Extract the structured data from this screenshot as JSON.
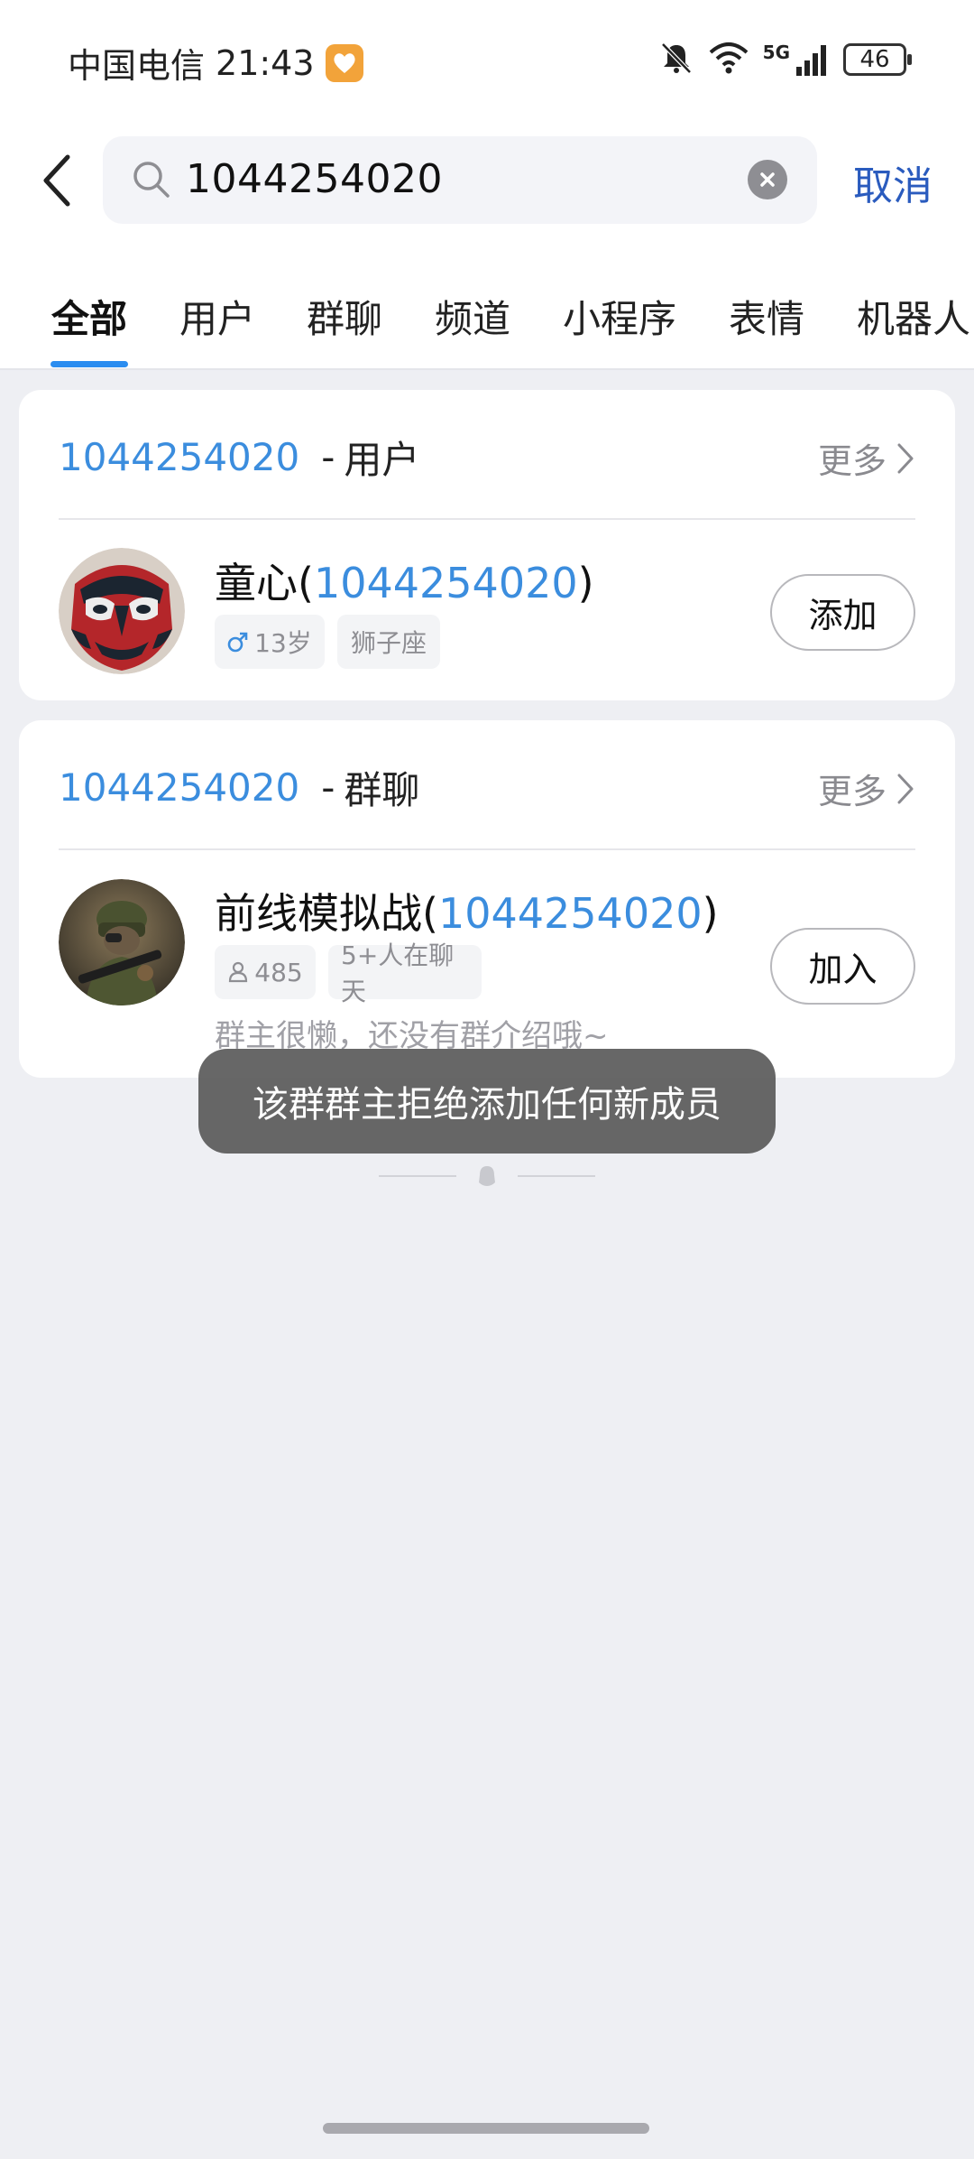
{
  "status_bar": {
    "carrier": "中国电信",
    "time": "21:43",
    "battery": "46",
    "network": "5G"
  },
  "search": {
    "query": "1044254020",
    "cancel_label": "取消"
  },
  "tabs": [
    {
      "label": "全部",
      "active": true
    },
    {
      "label": "用户",
      "active": false
    },
    {
      "label": "群聊",
      "active": false
    },
    {
      "label": "频道",
      "active": false
    },
    {
      "label": "小程序",
      "active": false
    },
    {
      "label": "表情",
      "active": false
    },
    {
      "label": "机器人",
      "active": false
    }
  ],
  "user_section": {
    "query": "1044254020",
    "separator": "-",
    "kind": "用户",
    "more_label": "更多",
    "result": {
      "name_prefix": "童心(",
      "name_id": "1044254020",
      "name_suffix": ")",
      "gender_icon": "male-icon",
      "age": "13岁",
      "zodiac": "狮子座",
      "action_label": "添加"
    }
  },
  "group_section": {
    "query": "1044254020",
    "separator": "-",
    "kind": "群聊",
    "more_label": "更多",
    "result": {
      "name_prefix": "前线模拟战(",
      "name_id": "1044254020",
      "name_suffix": ")",
      "member_count": "485",
      "active_tag": "5+人在聊天",
      "description": "群主很懒，还没有群介绍哦~",
      "action_label": "加入"
    }
  },
  "toast": {
    "message": "该群群主拒绝添加任何新成员"
  },
  "colors": {
    "highlight": "#3B8DDE",
    "accent_link": "#2A5BBE",
    "tab_indicator": "#2B8DF0",
    "background": "#EEEFF3"
  }
}
